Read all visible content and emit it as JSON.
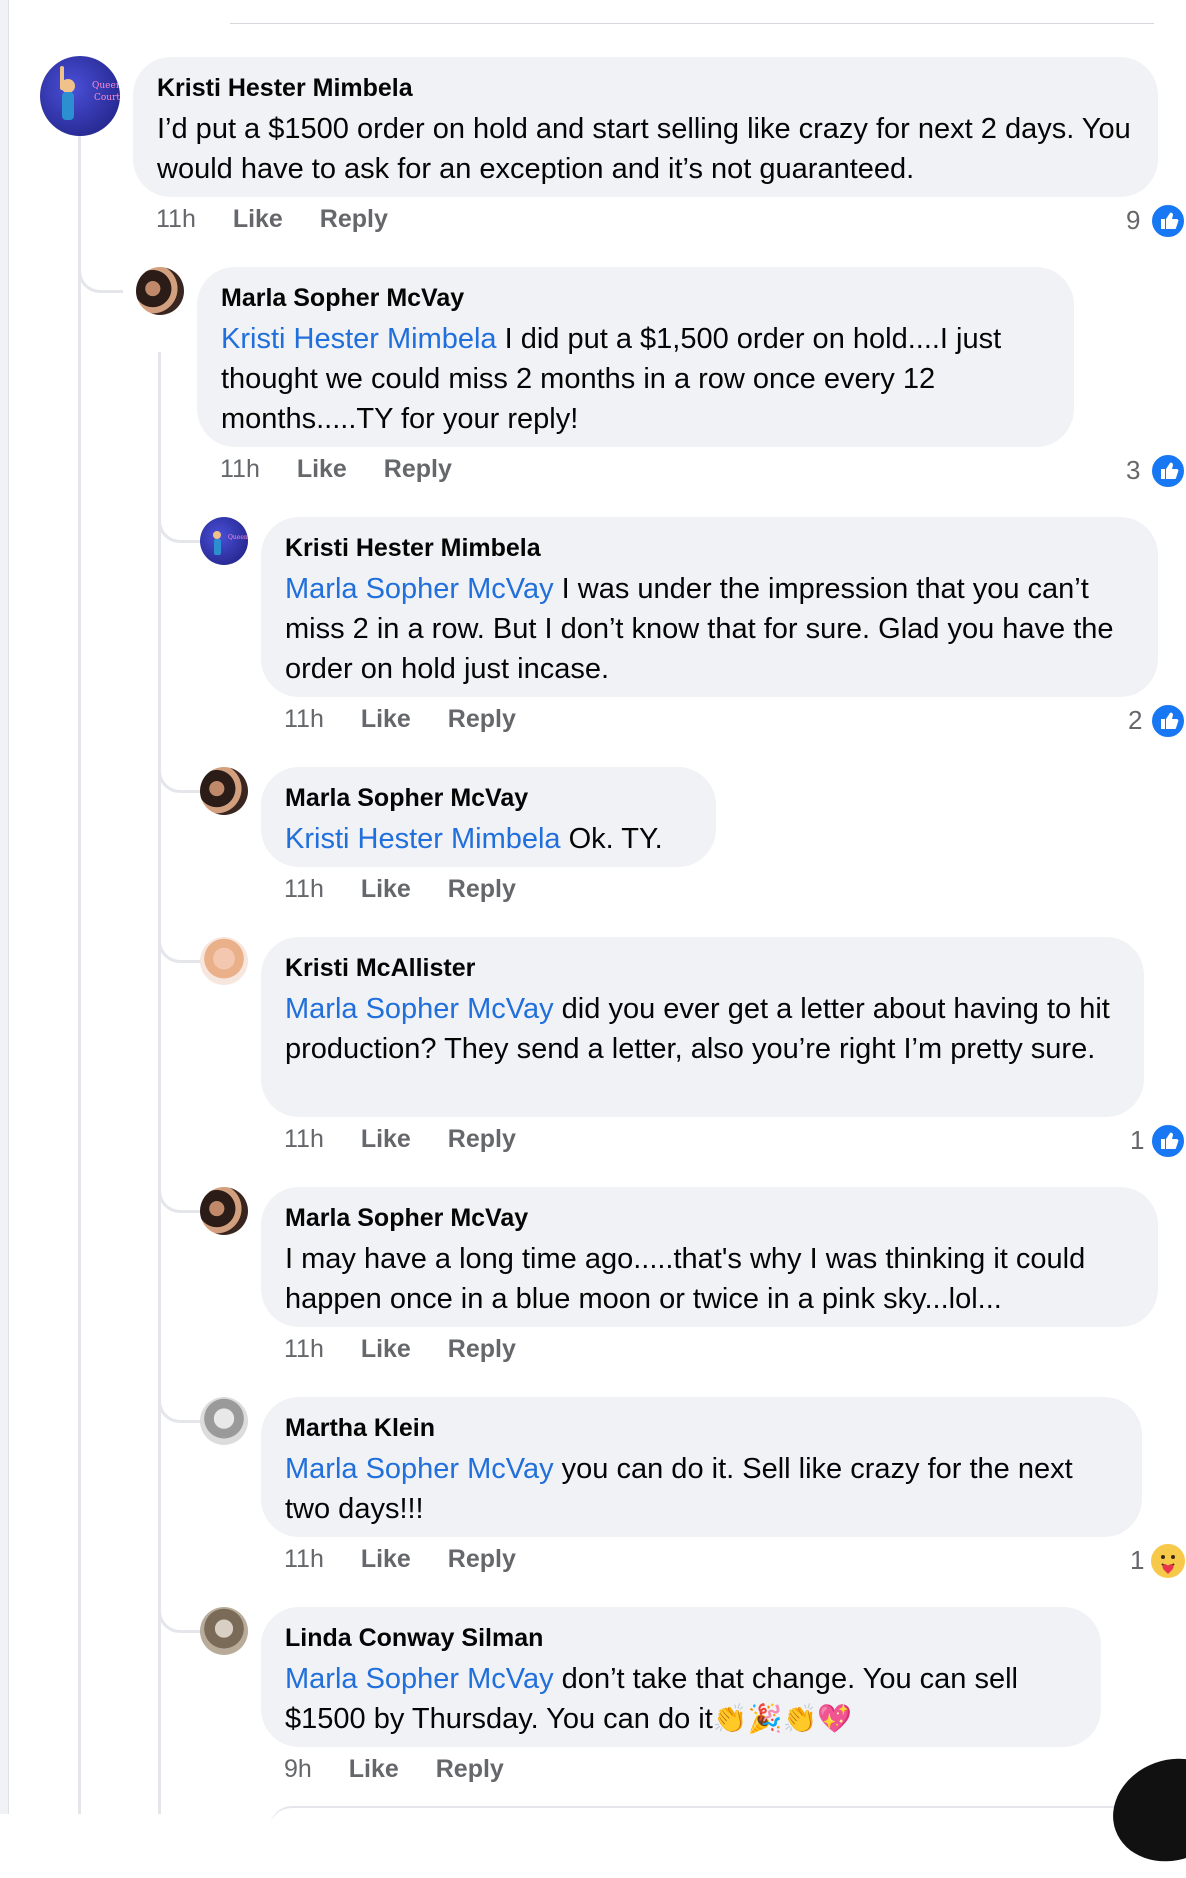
{
  "comments": [
    {
      "author": "Kristi Hester Mimbela",
      "mention": "",
      "text": "I’d put a $1500 order on hold and start selling like crazy for next 2 days. You would have to ask for an exception and it’s not guaranteed.",
      "time": "11h",
      "like": "Like",
      "reply": "Reply",
      "reaction_count": "9",
      "reaction": "like"
    },
    {
      "author": "Marla Sopher McVay",
      "mention": "Kristi Hester Mimbela",
      "text": " I did put a $1,500 order on hold....I just thought we could miss 2 months in a row once every 12 months.....TY for your reply!",
      "time": "11h",
      "like": "Like",
      "reply": "Reply",
      "reaction_count": "3",
      "reaction": "like"
    },
    {
      "author": "Kristi Hester Mimbela",
      "mention": "Marla Sopher McVay",
      "text": " I was under the impression that you can’t miss 2 in a row.  But I don’t know that for sure.  Glad you have the order on hold just incase.",
      "time": "11h",
      "like": "Like",
      "reply": "Reply",
      "reaction_count": "2",
      "reaction": "like"
    },
    {
      "author": "Marla Sopher McVay",
      "mention": "Kristi Hester Mimbela",
      "text": " Ok.  TY.",
      "time": "11h",
      "like": "Like",
      "reply": "Reply",
      "reaction_count": "",
      "reaction": ""
    },
    {
      "author": "Kristi McAllister",
      "mention": "Marla Sopher McVay",
      "text": " did you ever get a letter about having to hit production? They send a letter, also you’re right I’m pretty sure.",
      "time": "11h",
      "like": "Like",
      "reply": "Reply",
      "reaction_count": "1",
      "reaction": "like"
    },
    {
      "author": "Marla Sopher McVay",
      "mention": "",
      "text": "I may have a long time ago.....that's why I was thinking it could happen once in a blue moon or twice in a pink sky...lol...",
      "time": "11h",
      "like": "Like",
      "reply": "Reply",
      "reaction_count": "",
      "reaction": ""
    },
    {
      "author": "Martha Klein",
      "mention": "Marla Sopher McVay",
      "text": " you can do it. Sell like crazy for the next two days!!!",
      "time": "11h",
      "like": "Like",
      "reply": "Reply",
      "reaction_count": "1",
      "reaction": "care"
    },
    {
      "author": "Linda Conway Silman",
      "mention": "Marla Sopher McVay",
      "text": " don’t take that change.   You can sell $1500 by Thursday.  You can do it",
      "emoji": "👏🎉👏💖",
      "time": "9h",
      "like": "Like",
      "reply": "Reply",
      "reaction_count": "",
      "reaction": ""
    }
  ],
  "colors": {
    "bubble": "#f0f2f5",
    "mention": "#216fdb",
    "meta": "#65676b",
    "like_badge": "#1877f2"
  },
  "icons": {
    "like_reaction": "thumbs-up-icon",
    "care_reaction": "care-hug-icon"
  }
}
